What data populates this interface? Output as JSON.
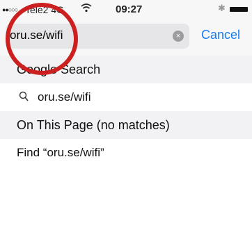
{
  "status_bar": {
    "signal": "●●○○○",
    "carrier": "Tele2 4G",
    "time": "09:27",
    "bluetooth": "✱"
  },
  "search": {
    "query": "oru.se/wifi",
    "cancel_label": "Cancel",
    "clear_icon": "×"
  },
  "sections": {
    "google_header": "Google Search",
    "suggestion_icon": "⌕",
    "suggestion": "oru.se/wifi",
    "page_header": "On This Page (no matches)",
    "find_label": "Find “oru.se/wifi”"
  },
  "colors": {
    "accent": "#1a7cf5",
    "annotation": "#cc2020"
  }
}
